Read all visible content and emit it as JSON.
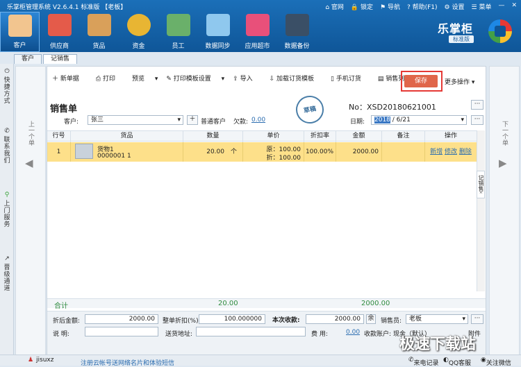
{
  "window": {
    "title": "乐掌柜管理系统 V2.6.4.1 标准版 【老板】",
    "menu": [
      "官网",
      "锁定",
      "导航",
      "帮助(F1)",
      "设置",
      "菜单"
    ]
  },
  "modules": [
    {
      "label": "客户",
      "icon": "customer-icon"
    },
    {
      "label": "供应商",
      "icon": "bus-icon"
    },
    {
      "label": "货品",
      "icon": "boxes-icon"
    },
    {
      "label": "资金",
      "icon": "money-bag-icon"
    },
    {
      "label": "员工",
      "icon": "staff-icon"
    },
    {
      "label": "数据同步",
      "icon": "sync-icon"
    },
    {
      "label": "应用超市",
      "icon": "basket-icon"
    },
    {
      "label": "数据备份",
      "icon": "backup-icon"
    }
  ],
  "brand": {
    "name": "乐掌柜",
    "edition": "标准版"
  },
  "tabs": [
    "客户",
    "记销售"
  ],
  "rail": [
    "快捷方式",
    "联系我们",
    "上门服务",
    "晋级通道"
  ],
  "nav": {
    "prev": "上一个单",
    "next": "下一个单"
  },
  "toolbar": {
    "new": "新单据",
    "print": "打印",
    "preview": "预览",
    "print_tpl": "打印模板设置",
    "import": "导入",
    "load_tpl": "加载订货模板",
    "mobile": "手机订货",
    "sales_list": "销售列表",
    "save": "保存",
    "more": "更多操作"
  },
  "form": {
    "title": "销售单",
    "stamp": "草稿",
    "no": "No：XSD20180621001",
    "customer_label": "客户:",
    "customer_value": "张三",
    "add_customer": "普通客户",
    "debt_label": "欠款:",
    "debt_value": "0.00",
    "date_label": "日期:",
    "date_year": "2018",
    "date_rest": "/ 6/21",
    "more_btn": "···"
  },
  "table": {
    "headers": [
      "行号",
      "货品",
      "数量",
      "单价",
      "折扣率",
      "金额",
      "备注",
      "操作"
    ],
    "row": {
      "no": "1",
      "name": "货物1",
      "code": "0000001 1",
      "qty": "20.00",
      "unit": "个",
      "orig": "原：100.00",
      "disc": "折：100.00",
      "rate": "100.00%",
      "amount": "2000.00",
      "ops": [
        "新增",
        "修改",
        "删除"
      ]
    },
    "side_tab": "记销售"
  },
  "totals": {
    "label": "合计",
    "qty": "20.00",
    "amount": "2000.00"
  },
  "footer": {
    "after_disc_label": "折后金额:",
    "after_disc": "2000.00",
    "whole_disc_label": "整单折扣(%)",
    "whole_disc": "100.000000",
    "this_pay_label": "本次收款:",
    "this_pay": "2000.00",
    "yu": "余",
    "sales_label": "销售员:",
    "sales_value": "老板",
    "note_label": "说    明:",
    "addr_label": "送货地址:",
    "fee_label": "费      用:",
    "fee_value": "0.00",
    "account_label": "收款账户:",
    "account_value": "现金（默认）",
    "attach": "附件"
  },
  "status": {
    "user": "jisuxz",
    "tip": "注册云帐号送网络名片和体验短信",
    "s1": "来电记录",
    "s2": "QQ客服",
    "s3": "关注微信"
  },
  "watermark": "极速下载站"
}
